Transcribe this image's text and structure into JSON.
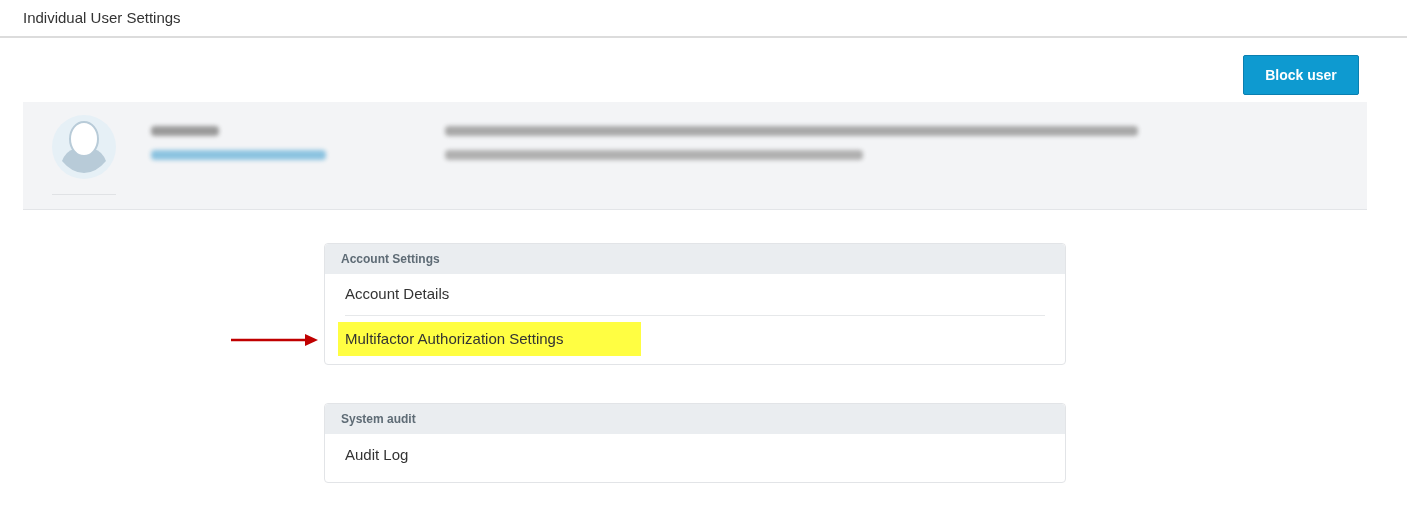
{
  "window": {
    "title": "Individual User Settings"
  },
  "actions": [
    {
      "label": "Block user"
    }
  ],
  "sections": [
    {
      "title": "Account Settings",
      "items": [
        {
          "label": "Account Details",
          "highlighted": false
        },
        {
          "label": "Multifactor Authorization Settings",
          "highlighted": true
        }
      ]
    },
    {
      "title": "System audit",
      "items": [
        {
          "label": "Audit Log",
          "highlighted": false
        }
      ]
    }
  ]
}
